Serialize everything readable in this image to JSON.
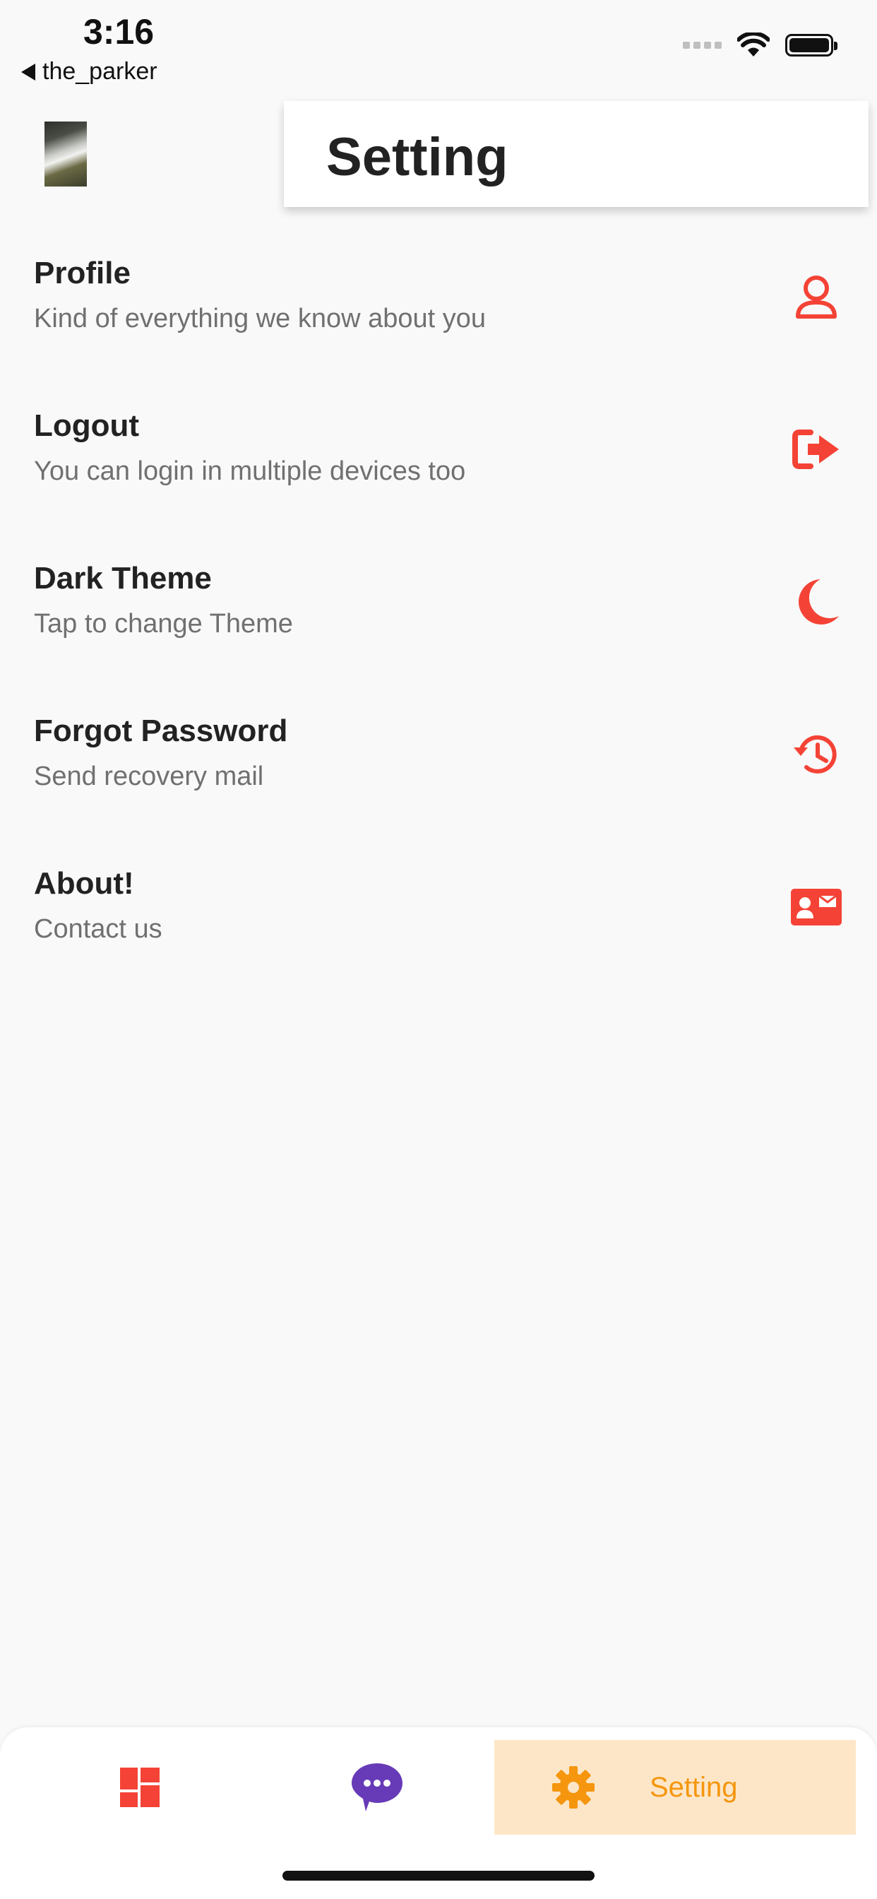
{
  "status_bar": {
    "time": "3:16",
    "back_label": "the_parker"
  },
  "header": {
    "title": "Setting"
  },
  "settings": [
    {
      "label": "Profile",
      "subtitle": "Kind of everything we know about you",
      "icon": "user-icon"
    },
    {
      "label": "Logout",
      "subtitle": "You can login in multiple devices too",
      "icon": "logout-icon"
    },
    {
      "label": "Dark Theme",
      "subtitle": "Tap to change Theme",
      "icon": "moon-icon"
    },
    {
      "label": "Forgot Password",
      "subtitle": "Send recovery mail",
      "icon": "history-icon"
    },
    {
      "label": "About!",
      "subtitle": "Contact us",
      "icon": "contact-card-icon"
    }
  ],
  "bottom_nav": {
    "items": [
      {
        "icon": "dashboard-icon",
        "label": ""
      },
      {
        "icon": "chat-bubble-icon",
        "label": ""
      },
      {
        "icon": "gear-icon",
        "label": "Setting",
        "active": true
      }
    ]
  },
  "colors": {
    "accent": "#f44336",
    "chat": "#673ab7",
    "active_tab": "#f5960e",
    "active_tab_bg": "#fde6c8"
  }
}
